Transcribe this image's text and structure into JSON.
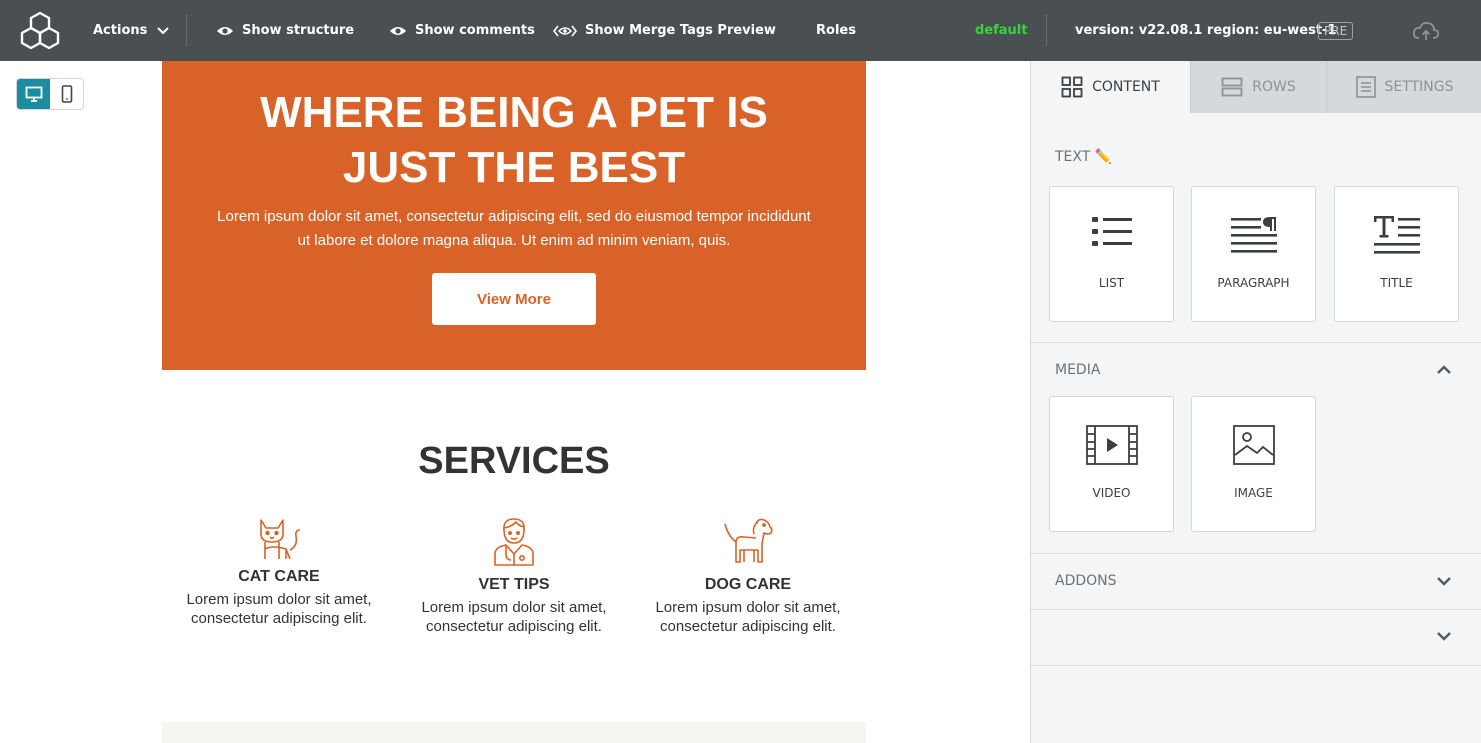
{
  "topbar": {
    "actions_label": "Actions",
    "show_structure_label": "Show structure",
    "show_comments_label": "Show comments",
    "show_merge_tags_label": "Show Merge Tags Preview",
    "roles_label": "Roles",
    "environment_label": "default",
    "version_label": "version: v22.08.1 region: eu-west-1",
    "pre_badge": "PRE",
    "environment_color": "#35d43a"
  },
  "canvas": {
    "hero": {
      "title_line1": "WHERE BEING A PET IS",
      "title_line2": "JUST THE BEST",
      "subtitle_line1": "Lorem ipsum dolor sit amet, consectetur adipiscing elit, sed do eiusmod tempor incididunt",
      "subtitle_line2": "ut labore et dolore magna aliqua. Ut enim ad minim veniam, quis.",
      "button_label": "View More",
      "background_color": "#d96228"
    },
    "services": {
      "title": "SERVICES",
      "items": [
        {
          "name": "CAT CARE",
          "text_line1": "Lorem ipsum dolor sit amet,",
          "text_line2": "consectetur adipiscing elit.",
          "icon": "cat-icon"
        },
        {
          "name": "VET TIPS",
          "text_line1": "Lorem ipsum dolor sit amet,",
          "text_line2": "consectetur adipiscing elit.",
          "icon": "vet-icon"
        },
        {
          "name": "DOG CARE",
          "text_line1": "Lorem ipsum dolor sit amet,",
          "text_line2": "consectetur adipiscing elit.",
          "icon": "dog-icon"
        }
      ]
    }
  },
  "panel": {
    "tabs": [
      {
        "label": "CONTENT",
        "active": true
      },
      {
        "label": "ROWS",
        "active": false
      },
      {
        "label": "SETTINGS",
        "active": false
      }
    ],
    "sections": {
      "text": {
        "label": "TEXT ✏️",
        "blocks": [
          "LIST",
          "PARAGRAPH",
          "TITLE"
        ]
      },
      "media": {
        "label": "MEDIA",
        "blocks": [
          "VIDEO",
          "IMAGE"
        ],
        "expanded": true
      },
      "addons": {
        "label": "ADDONS",
        "expanded": false
      }
    },
    "accent_color": "#1a8da0"
  }
}
